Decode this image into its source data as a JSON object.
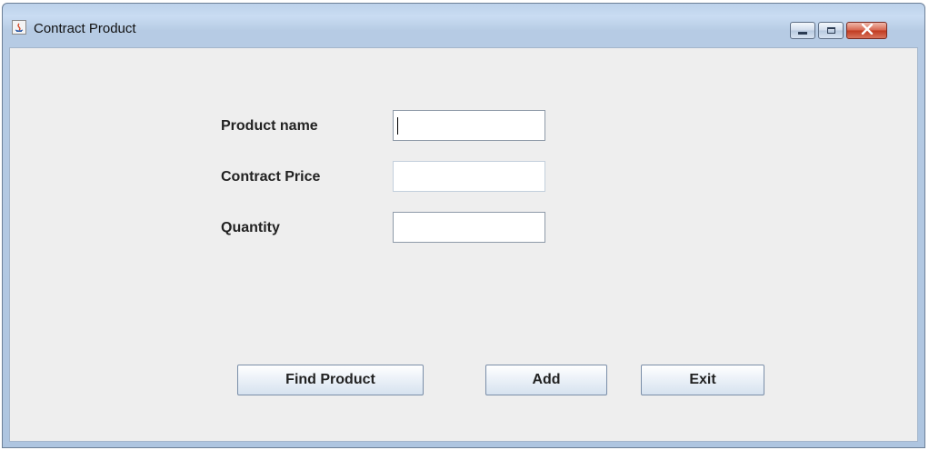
{
  "window": {
    "title": "Contract Product",
    "controls": [
      "minimize-icon",
      "maximize-icon",
      "close-icon"
    ]
  },
  "form": {
    "product_name_label": "Product name",
    "product_name_value": "",
    "contract_price_label": "Contract Price",
    "contract_price_value": "",
    "quantity_label": "Quantity",
    "quantity_value": ""
  },
  "buttons": {
    "find_product": "Find Product",
    "add": "Add",
    "exit": "Exit"
  },
  "colors": {
    "client_background": "#eeeeee",
    "close_button": "#c84a31",
    "title_bar": "#bcd1ea"
  }
}
